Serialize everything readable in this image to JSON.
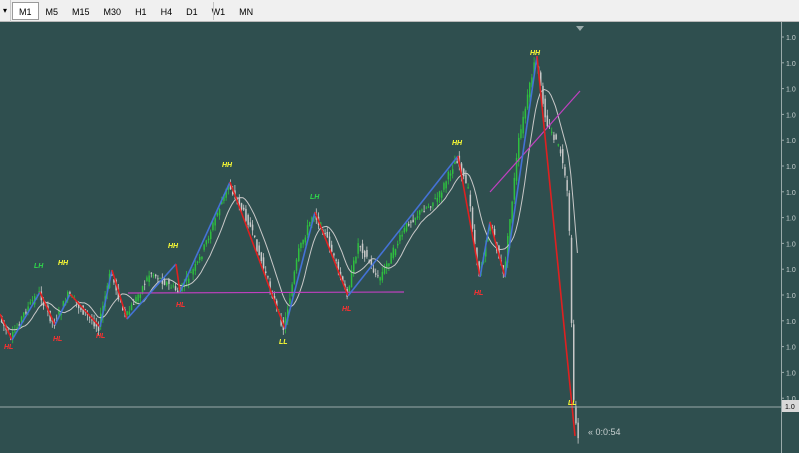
{
  "toolbar": {
    "menu_arrow": "▾",
    "timeframes": [
      "M1",
      "M5",
      "M15",
      "M30",
      "H1",
      "H4",
      "D1",
      "W1",
      "MN"
    ],
    "active_timeframe": "M1"
  },
  "chart": {
    "background": "#2f4f4f",
    "bull_color": "#2fbf3f",
    "bear_color": "#c8c8c8",
    "zigzag_up_color": "#4472d6",
    "zigzag_down_color": "#e02020",
    "support_color": "#c040c0",
    "ma_color": "#c8c8c8",
    "bid_line_color": "#9aaaaa",
    "countdown": "« 0:0:54",
    "price_labels": [
      "1.0",
      "1.0",
      "1.0",
      "1.0",
      "1.0",
      "1.0",
      "1.0",
      "1.0",
      "1.0",
      "1.0",
      "1.0",
      "1.0",
      "1.0",
      "1.0",
      "1.0"
    ],
    "current_price_tag": "1.0",
    "swing_labels": [
      {
        "text": "HL",
        "color": "#ff3030"
      },
      {
        "text": "LH",
        "color": "#2fd84a"
      },
      {
        "text": "HH",
        "color": "#ffff33"
      },
      {
        "text": "HL",
        "color": "#ff3030"
      },
      {
        "text": "HL",
        "color": "#ff3030"
      },
      {
        "text": "HH",
        "color": "#ffff33"
      },
      {
        "text": "HL",
        "color": "#ff3030"
      },
      {
        "text": "HH",
        "color": "#ffff33"
      },
      {
        "text": "LL",
        "color": "#ffff33"
      },
      {
        "text": "LH",
        "color": "#2fd84a"
      },
      {
        "text": "HL",
        "color": "#ff3030"
      },
      {
        "text": "HH",
        "color": "#ffff33"
      },
      {
        "text": "HL",
        "color": "#ff3030"
      },
      {
        "text": "HH",
        "color": "#ffff33"
      },
      {
        "text": "LL",
        "color": "#ffff33"
      }
    ]
  }
}
